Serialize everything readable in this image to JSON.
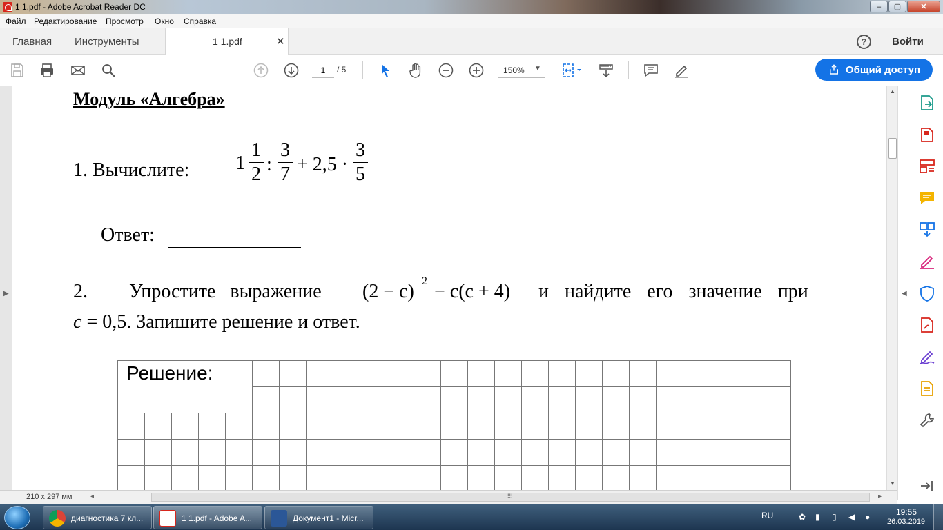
{
  "window": {
    "title": "1 1.pdf - Adobe Acrobat Reader DC",
    "min": "–",
    "max": "▢",
    "close": "✕"
  },
  "menu": [
    "Файл",
    "Редактирование",
    "Просмотр",
    "Окно",
    "Справка"
  ],
  "tabs": {
    "home": "Главная",
    "tools": "Инструменты",
    "document": "1 1.pdf",
    "close": "✕"
  },
  "header": {
    "help": "?",
    "sign_in": "Войти"
  },
  "toolbar": {
    "page_current": "1",
    "page_total": "/ 5",
    "zoom": "150%",
    "zoom_caret": "▼",
    "share": "Общий доступ"
  },
  "document": {
    "heading": "Модуль «Алгебра»",
    "q1_label": "1. Вычислите:",
    "q1_expr": {
      "whole": "1",
      "f1_num": "1",
      "f1_den": "2",
      "colon": ":",
      "f2_num": "3",
      "f2_den": "7",
      "plus": "+ 2,5 ·",
      "f3_num": "3",
      "f3_den": "5"
    },
    "answer_label": "Ответ:",
    "q2_num": "2.",
    "q2_text1": "Упростите выражение",
    "q2_expr": "(2 − c)",
    "q2_exp": "2",
    "q2_expr2": "− c(c + 4)",
    "q2_text2": "и найдите его значение при",
    "q2_line2_var": "c",
    "q2_line2_rest": " = 0,5. Запишите решение и ответ.",
    "solution_label": "Решение:"
  },
  "status": {
    "page_size": "210 x 297 мм",
    "left_arrow": "◂",
    "right_arrow": "▸",
    "grip": "⁞⁞⁞"
  },
  "taskbar": {
    "items": [
      "диагностика 7 кл...",
      "1 1.pdf - Adobe A...",
      "Документ1 - Micr..."
    ],
    "lang": "RU",
    "time": "19:55",
    "date": "26.03.2019"
  },
  "colors": {
    "accent": "#1473e6",
    "adobe_red": "#d8261c",
    "rail_icons": "#1473e6"
  }
}
